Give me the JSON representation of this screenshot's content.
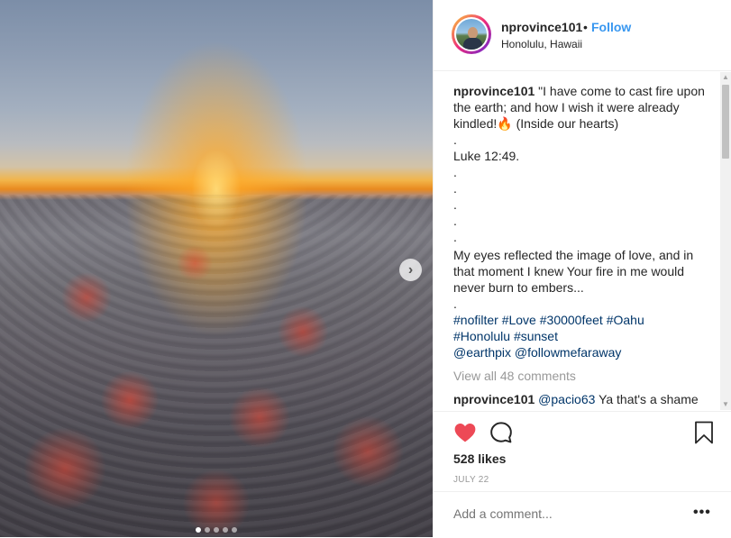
{
  "post": {
    "username": "nprovince101",
    "bullet": "•",
    "follow_label": "Follow",
    "location": "Honolulu, Hawaii"
  },
  "caption": {
    "username": "nprovince101",
    "line1": "\"I have come to cast fire upon the earth; and how I wish it were already kindled!🔥 (Inside our hearts)",
    "dot": ".",
    "verse": "Luke 12:49.",
    "paragraph": "My eyes reflected the image of love, and in that moment I knew Your fire in me would never burn to embers...",
    "hashtags": [
      "#nofilter",
      "#Love",
      "#30000feet",
      "#Oahu",
      "#Honolulu",
      "#sunset"
    ],
    "mentions": [
      "@earthpix",
      "@followmefaraway"
    ]
  },
  "view_all_comments": "View all 48 comments",
  "comment1": {
    "username": "nprovince101",
    "mention": "@pacio63",
    "text": "Ya that's a shame that someone lied about such a beautiful"
  },
  "likes": "528 likes",
  "date": "JULY 22",
  "add_comment_placeholder": "Add a comment...",
  "more_label": "•••",
  "carousel": {
    "count": 5,
    "active": 1
  },
  "colors": {
    "accent": "#3897f0",
    "heart": "#ed4956",
    "tag": "#003569"
  },
  "icons": [
    "next-arrow-icon",
    "heart-icon",
    "comment-icon",
    "bookmark-icon",
    "more-icon"
  ]
}
